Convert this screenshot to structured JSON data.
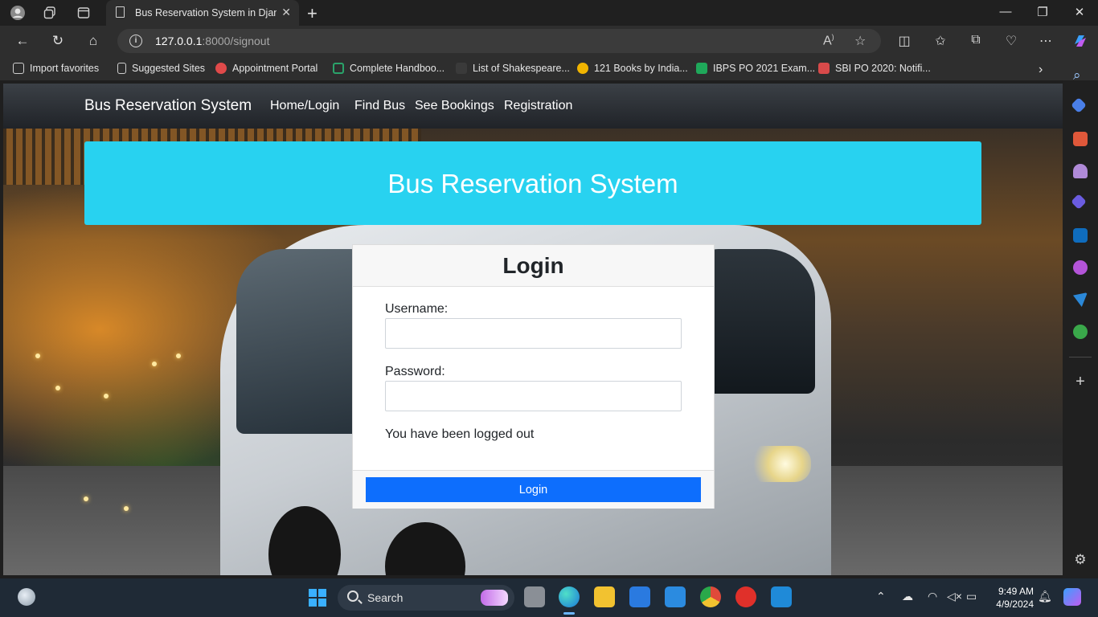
{
  "browser": {
    "tab_title": "Bus Reservation System in Djang",
    "url_host": "127.0.0.1",
    "url_rest": ":8000/signout"
  },
  "favorites": [
    {
      "label": "Import favorites",
      "color": "#cfcfcf"
    },
    {
      "label": "Suggested Sites",
      "color": "#cfcfcf"
    },
    {
      "label": "Appointment Portal",
      "color": "#e04a4a"
    },
    {
      "label": "Complete Handboo...",
      "color": "#2aa36a"
    },
    {
      "label": "List of Shakespeare...",
      "color": "#555555"
    },
    {
      "label": "121 Books by India...",
      "color": "#f0b400"
    },
    {
      "label": "IBPS PO 2021 Exam...",
      "color": "#1fa85a"
    },
    {
      "label": "SBI PO 2020: Notifi...",
      "color": "#d84a4a"
    }
  ],
  "site": {
    "brand": "Bus Reservation System",
    "nav": [
      "Home/Login",
      "Find Bus",
      "See Bookings",
      "Registration"
    ],
    "banner_title": "Bus Reservation System",
    "login": {
      "heading": "Login",
      "username_label": "Username:",
      "username_value": "",
      "password_label": "Password:",
      "password_value": "",
      "message": "You have been logged out",
      "button": "Login"
    }
  },
  "taskbar": {
    "search_label": "Search",
    "time": "9:49 AM",
    "date": "4/9/2024"
  },
  "colors": {
    "banner": "#28d2f0",
    "primary_button": "#0d6efd",
    "navbar": "#212529"
  }
}
